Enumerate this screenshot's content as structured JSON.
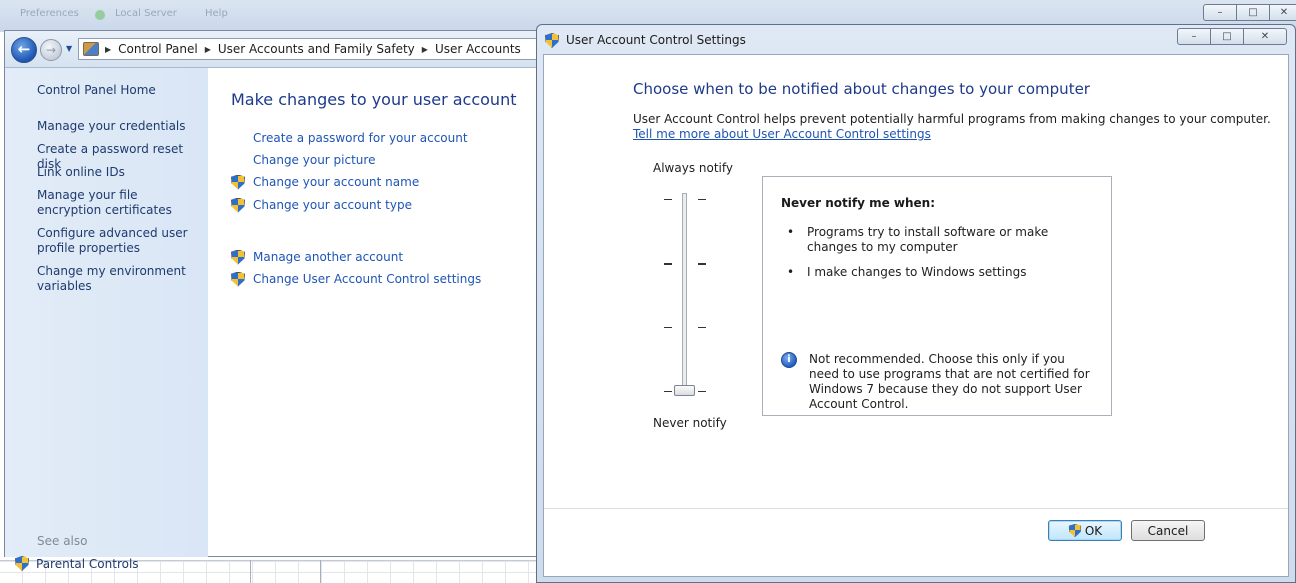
{
  "background": {
    "menu_items": [
      "Preferences",
      "Local Server",
      "Help"
    ]
  },
  "explorer": {
    "breadcrumb": [
      "Control Panel",
      "User Accounts and Family Safety",
      "User Accounts"
    ],
    "sidebar": {
      "home": "Control Panel Home",
      "links": [
        "Manage your credentials",
        "Create a password reset disk",
        "Link online IDs",
        "Manage your file encryption certificates",
        "Configure advanced user profile properties",
        "Change my environment variables"
      ],
      "see_also": "See also",
      "parental_controls": "Parental Controls"
    },
    "content": {
      "title": "Make changes to your user account",
      "links": [
        {
          "label": "Create a password for your account",
          "shield": false
        },
        {
          "label": "Change your picture",
          "shield": false
        },
        {
          "label": "Change your account name",
          "shield": true
        },
        {
          "label": "Change your account type",
          "shield": true
        },
        {
          "label": "Manage another account",
          "shield": true
        },
        {
          "label": "Change User Account Control settings",
          "shield": true
        }
      ]
    }
  },
  "uac_dialog": {
    "title": "User Account Control Settings",
    "heading": "Choose when to be notified about changes to your computer",
    "description": "User Account Control helps prevent potentially harmful programs from making changes to your computer.",
    "more_link": "Tell me more about User Account Control settings",
    "slider": {
      "top_label": "Always notify",
      "bottom_label": "Never notify",
      "levels": 4,
      "current_level": 1
    },
    "info": {
      "title": "Never notify me when:",
      "items": [
        "Programs try to install software or make changes to my computer",
        "I make changes to Windows settings"
      ],
      "note": "Not recommended. Choose this only if you need to use programs that are not certified for Windows 7 because they do not support User Account Control."
    },
    "buttons": {
      "ok": "OK",
      "cancel": "Cancel"
    }
  },
  "icons": {
    "shield": "uac-shield-icon",
    "info": "info-icon",
    "back": "back-arrow-icon",
    "forward": "forward-arrow-icon"
  }
}
